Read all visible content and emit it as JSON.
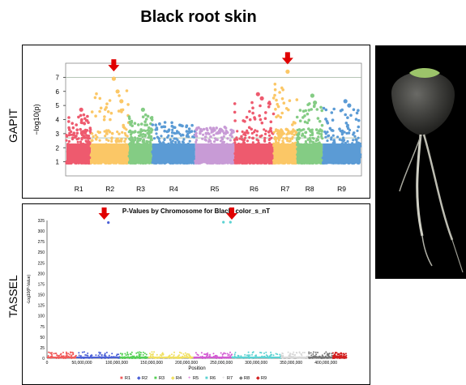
{
  "title": "Black root skin",
  "labels": {
    "gapit": "GAPIT",
    "tassel": "TASSEL"
  },
  "chart_data": [
    {
      "type": "scatter",
      "subtype": "manhattan",
      "panel": "GAPIT",
      "xlabel": "",
      "ylabel": "−log10(p)",
      "ylim": [
        0,
        8
      ],
      "yticks": [
        1,
        2,
        3,
        4,
        5,
        6,
        7
      ],
      "grid": false,
      "threshold_lines": [
        7,
        2.7
      ],
      "chromosomes": [
        "R1",
        "R2",
        "R3",
        "R4",
        "R5",
        "R6",
        "R7",
        "R8",
        "R9"
      ],
      "chrom_widths": [
        1.0,
        1.55,
        0.95,
        1.75,
        1.6,
        1.6,
        0.95,
        1.05,
        1.55
      ],
      "colors": [
        "#ee5a6e",
        "#fbc766",
        "#84cc84",
        "#5b9bd5",
        "#c89bd6",
        "#ee5a6e",
        "#fbc766",
        "#84cc84",
        "#5b9bd5"
      ],
      "max_values": [
        4.7,
        6.9,
        4.7,
        4.0,
        3.6,
        5.8,
        7.4,
        5.7,
        5.3
      ],
      "peak_points": [
        {
          "chrom": "R2",
          "y": 6.9
        },
        {
          "chrom": "R2",
          "y": 6.0
        },
        {
          "chrom": "R2",
          "y": 5.3
        },
        {
          "chrom": "R6",
          "y": 5.8
        },
        {
          "chrom": "R6",
          "y": 5.5
        },
        {
          "chrom": "R7",
          "y": 7.4
        },
        {
          "chrom": "R8",
          "y": 5.7
        },
        {
          "chrom": "R8",
          "y": 5.2
        },
        {
          "chrom": "R9",
          "y": 5.3
        },
        {
          "chrom": "R9",
          "y": 5.0
        },
        {
          "chrom": "R3",
          "y": 4.7
        },
        {
          "chrom": "R1",
          "y": 4.7
        }
      ],
      "arrows": [
        "R2",
        "R7"
      ]
    },
    {
      "type": "scatter",
      "subtype": "manhattan",
      "panel": "TASSEL",
      "title": "P-Values by Chromosome for Black_color_s_nT",
      "xlabel": "Position",
      "ylabel": "-Log10(P-Value)",
      "ylim": [
        0,
        325
      ],
      "yticks": [
        0,
        25,
        50,
        75,
        100,
        125,
        150,
        175,
        200,
        225,
        250,
        275,
        300,
        325
      ],
      "xlim": [
        0,
        430000000
      ],
      "xticks": [
        0,
        50000000,
        100000000,
        150000000,
        200000000,
        250000000,
        300000000,
        350000000,
        400000000
      ],
      "xtick_labels": [
        "0",
        "50,000,000",
        "100,000,000",
        "150,000,000",
        "200,000,000",
        "250,000,000",
        "300,000,000",
        "350,000,000",
        "400,000,000"
      ],
      "chromosomes": [
        "R1",
        "R2",
        "R3",
        "R4",
        "R5",
        "R6",
        "R7",
        "R8",
        "R9"
      ],
      "chrom_ranges": [
        [
          0,
          42000000
        ],
        [
          42000000,
          105000000
        ],
        [
          105000000,
          145000000
        ],
        [
          145000000,
          210000000
        ],
        [
          210000000,
          265000000
        ],
        [
          265000000,
          335000000
        ],
        [
          335000000,
          375000000
        ],
        [
          375000000,
          410000000
        ],
        [
          410000000,
          430000000
        ]
      ],
      "colors": [
        "#f05a5a",
        "#4a5fd6",
        "#55d055",
        "#f0e060",
        "#d25ad2",
        "#5ad2d2",
        "#d8d8d8",
        "#777777",
        "#d21e1e"
      ],
      "legend_markers": [
        "■",
        "◆",
        "■",
        "◆",
        "+",
        "■",
        "+",
        "◆",
        "◆"
      ],
      "peak_points": [
        {
          "chrom": "R2",
          "x": 88000000,
          "y": 320
        },
        {
          "chrom": "R6",
          "x": 253000000,
          "y": 321
        },
        {
          "chrom": "R6",
          "x": 263000000,
          "y": 321
        }
      ],
      "baseline_max": 15,
      "arrows_x": [
        82000000,
        265000000
      ],
      "legend": [
        "R1",
        "R2",
        "R3",
        "R4",
        "R5",
        "R6",
        "R7",
        "R8",
        "R9"
      ],
      "legend_position": "bottom"
    }
  ]
}
